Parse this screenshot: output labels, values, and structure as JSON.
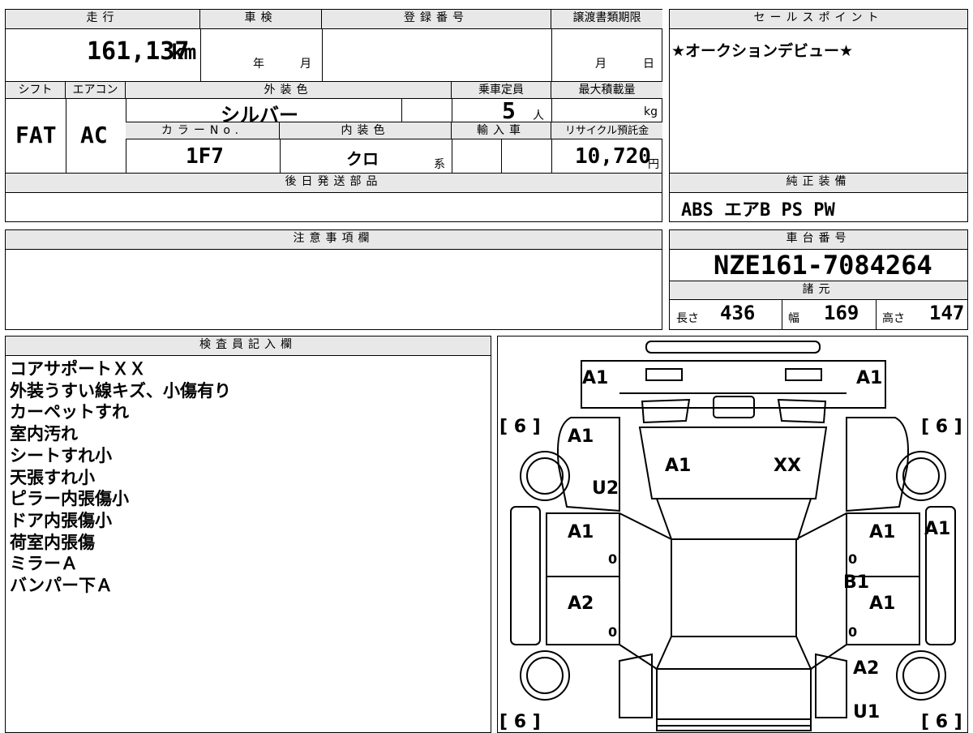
{
  "headers": {
    "mileage": "走行",
    "inspection": "車検",
    "registration": "登録番号",
    "transfer_deadline": "譲渡書類期限",
    "sales_point": "セールスポイント",
    "shift": "シフト",
    "aircon": "エアコン",
    "exterior_color": "外装色",
    "capacity": "乗車定員",
    "max_load": "最大積載量",
    "color_no": "カラーNo.",
    "interior_color": "内装色",
    "import": "輸入車",
    "recycle": "リサイクル預託金",
    "later_parts": "後日発送部品",
    "standard_equipment": "純正装備",
    "notes": "注意事項欄",
    "chassis_number": "車台番号",
    "specs": "諸元",
    "inspector": "検査員記入欄"
  },
  "values": {
    "mileage": "161,137",
    "mileage_unit": "km",
    "inspection_year": "年",
    "inspection_month": "月",
    "transfer_month": "月",
    "transfer_day": "日",
    "sales_point": "★オークションデビュー★",
    "shift": "FAT",
    "aircon": "AC",
    "exterior_color": "シルバー",
    "capacity": "5",
    "capacity_unit": "人",
    "max_load_unit": "kg",
    "color_no": "1F7",
    "interior_color": "クロ",
    "interior_suffix": "系",
    "recycle": "10,720",
    "recycle_unit": "円",
    "standard_equipment": "ABS エアB PS PW",
    "chassis_number": "NZE161-7084264",
    "length_label": "長さ",
    "length": "436",
    "width_label": "幅",
    "width": "169",
    "height_label": "高さ",
    "height": "147"
  },
  "remarks": [
    "コアサポートＸＸ",
    "外装うすい線キズ、小傷有り",
    "カーペットすれ",
    "室内汚れ",
    "シートすれ小",
    "天張すれ小",
    "ピラー内張傷小",
    "ドア内張傷小",
    "荷室内張傷",
    "ミラーＡ",
    "バンパー下Ａ"
  ],
  "diagram": {
    "tire_labels": [
      "[ 6 ]",
      "[ 6 ]",
      "[ 6 ]",
      "[ 6 ]"
    ],
    "marks": {
      "front_bumper_left": "A1",
      "front_bumper_right": "A1",
      "left_fender": "A1",
      "hood": "A1",
      "core_support": "XX",
      "left_fender_lower": "U2",
      "left_front_door": "A1",
      "left_rear_door": "A2",
      "right_front_door": "A1",
      "right_rear_door": "A1",
      "right_pillar": "A1",
      "right_step": "B1",
      "right_quarter": "A2",
      "rear_bumper": "U1",
      "door_zero_1": "0",
      "door_zero_2": "0",
      "door_zero_3": "0",
      "door_zero_4": "0"
    }
  }
}
